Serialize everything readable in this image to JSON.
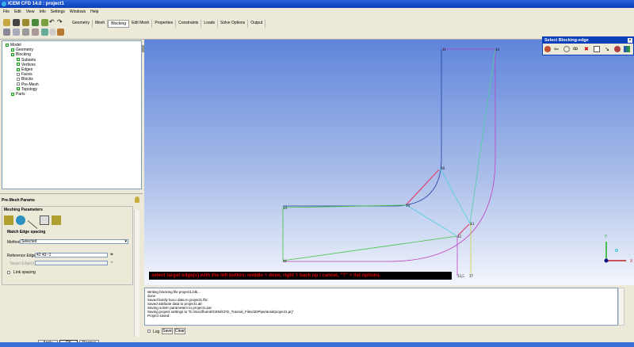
{
  "window": {
    "title": "ICEM CFD 14.0 : project1"
  },
  "menu": [
    "File",
    "Edit",
    "View",
    "Info",
    "Settings",
    "Windows",
    "Help"
  ],
  "tabs": [
    {
      "label": "Geometry"
    },
    {
      "label": "Mesh"
    },
    {
      "label": "Blocking",
      "active": true
    },
    {
      "label": "Edit Mesh"
    },
    {
      "label": "Properties"
    },
    {
      "label": "Constraints"
    },
    {
      "label": "Loads"
    },
    {
      "label": "Solve Options"
    },
    {
      "label": "Output"
    }
  ],
  "tree": [
    {
      "label": "Model",
      "level": 0,
      "checked": true
    },
    {
      "label": "Geometry",
      "level": 1,
      "checked": true
    },
    {
      "label": "Blocking",
      "level": 1,
      "checked": true
    },
    {
      "label": "Subsets",
      "level": 2,
      "checked": true
    },
    {
      "label": "Vertices",
      "level": 2,
      "checked": true
    },
    {
      "label": "Edges",
      "level": 2,
      "checked": true
    },
    {
      "label": "Faces",
      "level": 2,
      "checked": false
    },
    {
      "label": "Blocks",
      "level": 2,
      "checked": false
    },
    {
      "label": "Pre-Mesh",
      "level": 2,
      "checked": false
    },
    {
      "label": "Topology",
      "level": 2,
      "checked": true
    },
    {
      "label": "Parts",
      "level": 1,
      "checked": true
    }
  ],
  "params": {
    "title": "Pre-Mesh Params",
    "group": "Meshing Parameters",
    "subgroup": "Match Edge spacing",
    "method_label": "Method",
    "method_value": "Selected",
    "ref_edge_label": "Reference Edge",
    "ref_edge_value": "42 43 -1",
    "target_edge_label": "Target Edge(s)",
    "link_spacing_label": "Link spacing",
    "apply": "Apply",
    "ok": "OK",
    "dismiss": "Dismiss"
  },
  "prompt": "select target edge(s) with the left button: middle = done, right = back up / cancel, \"?\" = list options.",
  "select_panel": {
    "title": "Select Blocking-edge"
  },
  "vertices": [
    "11",
    "44",
    "38",
    "34",
    "13",
    "41",
    "42",
    "43",
    "33,5",
    "37"
  ],
  "axes": {
    "y": "Y",
    "x": "X"
  },
  "log": {
    "lines": [
      "Writing blocking file project1.blk...",
      "done",
      "Saved family boco data to project1.fbc",
      "Saved attribute data to project1.atr",
      "Saving solver parameters to project1.par",
      "Saving project settings to \"E:/misc/fluent/ICEM/CFD_Tutorial_Files/2DPipe/ansit/project1.prj\"",
      "Project saved."
    ],
    "log_label": "Log",
    "save": "Save",
    "clear": "Clear"
  },
  "colors": {
    "title_bar": "#0a3fb8",
    "prompt_text": "#e00000"
  }
}
